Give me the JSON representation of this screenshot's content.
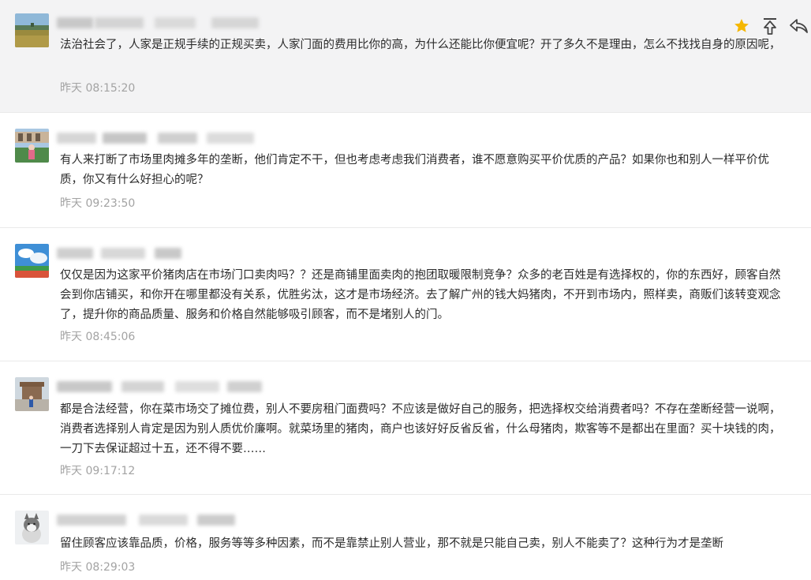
{
  "comments": [
    {
      "text": "法治社会了，人家是正规手续的正规买卖，人家门面的费用比你的高，为什么还能比你便宜呢？开了多久不是理由，怎么不找找自身的原因呢，",
      "time": "昨天 08:15:20",
      "avatar": "field-landscape",
      "highlighted": true
    },
    {
      "text": "有人来打断了市场里肉摊多年的垄断，他们肯定不干，但也考虑考虑我们消费者，谁不愿意购买平价优质的产品？如果你也和别人一样平价优质，你又有什么好担心的呢？",
      "time": "昨天 09:23:50",
      "avatar": "castle-garden-person"
    },
    {
      "text": "仅仅是因为这家平价猪肉店在市场门口卖肉吗？？还是商铺里面卖肉的抱团取暖限制竞争？众多的老百姓是有选择权的，你的东西好，顾客自然会到你店铺买，和你开在哪里都没有关系，优胜劣汰，这才是市场经济。去了解广州的钱大妈猪肉，不开到市场内，照样卖，商贩们该转变观念了，提升你的商品质量、服务和价格自然能够吸引顾客，而不是堵别人的门。",
      "time": "昨天 08:45:06",
      "avatar": "sky-track"
    },
    {
      "text": "都是合法经营，你在菜市场交了摊位费，别人不要房租门面费吗？不应该是做好自己的服务，把选择权交给消费者吗？不存在垄断经营一说啊，消费者选择别人肯定是因为别人质优价廉啊。就菜场里的猪肉，商户也该好好反省反省，什么母猪肉，欺客等不是都出在里面？买十块钱的肉，一刀下去保证超过十五，还不得不要……",
      "time": "昨天 09:17:12",
      "avatar": "palace-person"
    },
    {
      "text": "留住顾客应该靠品质，价格，服务等等多种因素，而不是靠禁止别人营业，那不就是只能自己卖，别人不能卖了？这种行为才是垄断",
      "time": "昨天 08:29:03",
      "avatar": "husky-puppy"
    }
  ],
  "actions": {
    "star": "star-icon",
    "top": "pin-to-top-icon",
    "reply": "reply-icon",
    "star_color": "#f5b700"
  }
}
